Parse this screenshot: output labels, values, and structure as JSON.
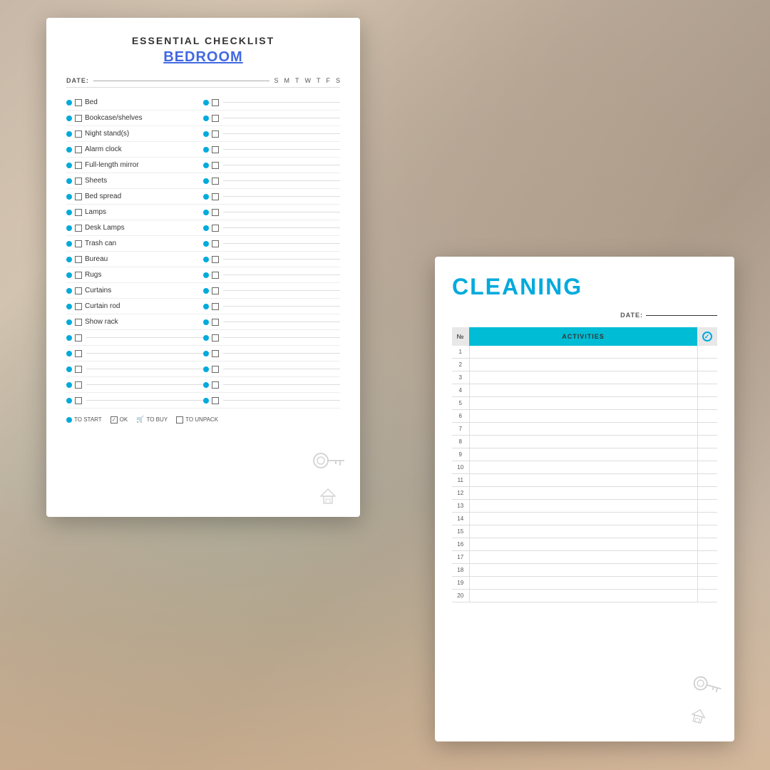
{
  "background": {
    "color_start": "#c8b8a8",
    "color_end": "#a08878"
  },
  "bedroom_card": {
    "main_title": "ESSENTIAL CHECKLIST",
    "subtitle": "BEDROOM",
    "date_label": "DATE:",
    "day_labels": [
      "S",
      "M",
      "T",
      "W",
      "T",
      "F",
      "S"
    ],
    "items_left": [
      "Bed",
      "Bookcase/shelves",
      "Night stand(s)",
      "Alarm clock",
      "Full-length mirror",
      "Sheets",
      "Bed spread",
      "Lamps",
      "Desk Lamps",
      "Trash can",
      "Bureau",
      "Rugs",
      "Curtains",
      "Curtain rod",
      "Show rack",
      "",
      "",
      "",
      "",
      ""
    ],
    "items_right": [
      "",
      "",
      "",
      "",
      "",
      "",
      "",
      "",
      "",
      "",
      "",
      "",
      "",
      "",
      "",
      "",
      "",
      "",
      "",
      ""
    ],
    "legend": {
      "to_start": "TO START",
      "ok": "OK",
      "to_buy": "TO BUY",
      "to_unpack": "TO UNPACK"
    }
  },
  "cleaning_card": {
    "title": "CLEANING",
    "date_label": "DATE:",
    "table_headers": {
      "num": "№",
      "activities": "ACTIVITIES",
      "check": "✓"
    },
    "rows": [
      {
        "num": "1"
      },
      {
        "num": "2"
      },
      {
        "num": "3"
      },
      {
        "num": "4"
      },
      {
        "num": "5"
      },
      {
        "num": "6"
      },
      {
        "num": "7"
      },
      {
        "num": "8"
      },
      {
        "num": "9"
      },
      {
        "num": "10"
      },
      {
        "num": "11"
      },
      {
        "num": "12"
      },
      {
        "num": "13"
      },
      {
        "num": "14"
      },
      {
        "num": "15"
      },
      {
        "num": "16"
      },
      {
        "num": "17"
      },
      {
        "num": "18"
      },
      {
        "num": "19"
      },
      {
        "num": "20"
      }
    ]
  }
}
